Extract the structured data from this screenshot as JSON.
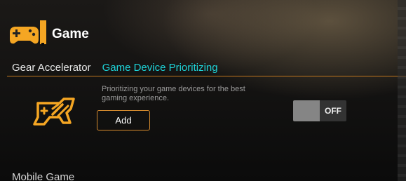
{
  "header": {
    "title": "Game",
    "logo_icon": "gamepad-icon",
    "accent_color": "#f5a623"
  },
  "tabs": [
    {
      "label": "Gear Accelerator",
      "active": false
    },
    {
      "label": "Game Device Prioritizing",
      "active": true,
      "color": "#1ed3d8"
    }
  ],
  "feature": {
    "icon": "rocket-gamepad-icon",
    "description": "Prioritizing your game devices for the best gaming experience.",
    "add_label": "Add",
    "toggle_label": "OFF",
    "toggle_on": false
  },
  "mobile_section": {
    "title": "Mobile Game"
  }
}
